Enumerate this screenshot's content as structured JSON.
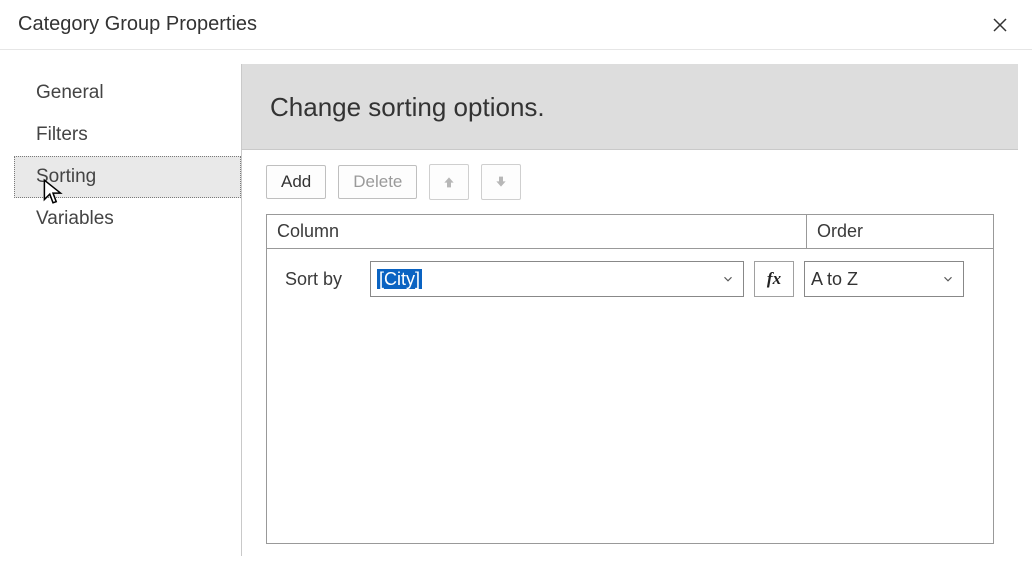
{
  "window": {
    "title": "Category Group Properties"
  },
  "sidebar": {
    "items": [
      {
        "label": "General"
      },
      {
        "label": "Filters"
      },
      {
        "label": "Sorting"
      },
      {
        "label": "Variables"
      }
    ],
    "selected_index": 2
  },
  "main": {
    "heading": "Change sorting options.",
    "toolbar": {
      "add_label": "Add",
      "delete_label": "Delete"
    },
    "table": {
      "column_header": "Column",
      "order_header": "Order",
      "row": {
        "label": "Sort by",
        "value": "[City]",
        "order": "A to Z"
      }
    },
    "fx_label": "fx"
  }
}
